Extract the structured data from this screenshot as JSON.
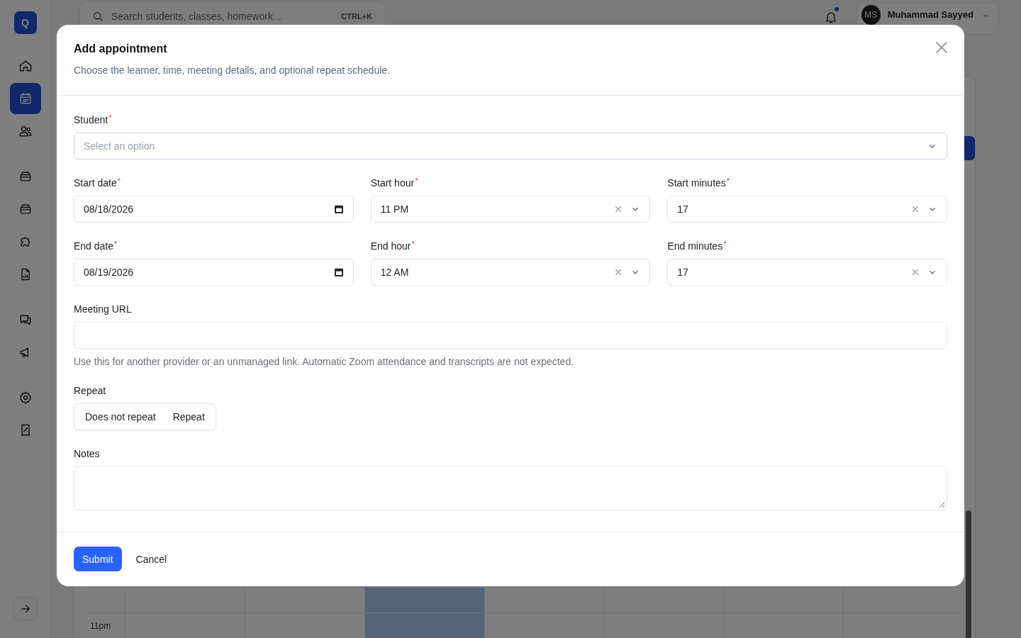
{
  "sidebar": {
    "logo": "Q",
    "items": [
      {
        "selected": false
      },
      {
        "selected": true
      },
      {
        "selected": false
      },
      {
        "selected": false
      },
      {
        "selected": false
      },
      {
        "selected": false
      },
      {
        "selected": false
      },
      {
        "selected": false
      },
      {
        "selected": false
      },
      {
        "selected": false
      },
      {
        "selected": false
      }
    ]
  },
  "topbar": {
    "search": {
      "placeholder": "Search students, classes, homework...",
      "shortcut": "CTRL+K"
    },
    "notifications": {
      "unread": true
    },
    "user": {
      "initials": "MS",
      "name": "Muhammad Sayyed"
    }
  },
  "calendar": {
    "columns": [
      {
        "today": false
      },
      {
        "today": false
      },
      {
        "today": true
      },
      {
        "today": false
      },
      {
        "today": false
      },
      {
        "today": false
      },
      {
        "today": false
      }
    ],
    "rows": [
      {
        "time": "11pm"
      }
    ]
  },
  "dialog": {
    "title": "Add appointment",
    "description": "Choose the learner, time, meeting details, and optional repeat schedule.",
    "rows": [
      [
        {
          "kind": "select",
          "label": "Student",
          "required_mark": "*",
          "placeholder": "Select an option",
          "focused": true
        }
      ],
      [
        {
          "kind": "date",
          "label": "Start date",
          "required_mark": "*",
          "value": "08/18/2026"
        },
        {
          "kind": "select",
          "label": "Start hour",
          "required_mark": "*",
          "value": "11 PM",
          "clearable": true
        },
        {
          "kind": "select",
          "label": "Start minutes",
          "required_mark": "*",
          "value": "17",
          "clearable": true
        }
      ],
      [
        {
          "kind": "date",
          "label": "End date",
          "required_mark": "*",
          "value": "08/19/2026"
        },
        {
          "kind": "select",
          "label": "End hour",
          "required_mark": "*",
          "value": "12 AM",
          "clearable": true
        },
        {
          "kind": "select",
          "label": "End minutes",
          "required_mark": "*",
          "value": "17",
          "clearable": true
        }
      ],
      [
        {
          "kind": "text",
          "label": "Meeting URL",
          "help": "Use this for another provider or an unmanaged link. Automatic Zoom attendance and transcripts are not expected."
        }
      ],
      [
        {
          "kind": "segmented",
          "label": "Repeat",
          "options": [
            {
              "label": "Does not repeat",
              "selected": false
            },
            {
              "label": "Repeat",
              "selected": false
            }
          ]
        }
      ],
      [
        {
          "kind": "textarea",
          "label": "Notes"
        }
      ]
    ],
    "buttons": [
      {
        "label": "Submit",
        "kind": "primary"
      },
      {
        "label": "Cancel",
        "kind": "plain"
      }
    ]
  }
}
